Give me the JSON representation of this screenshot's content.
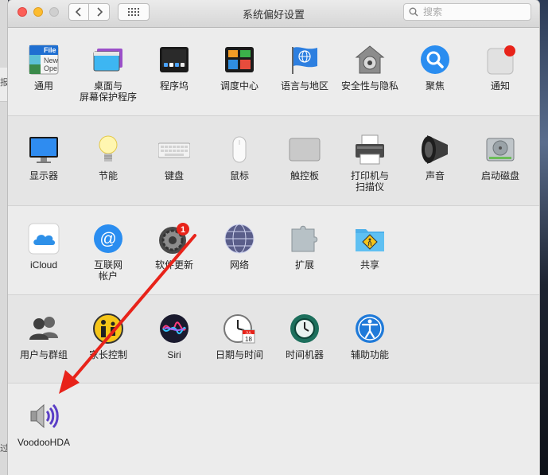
{
  "window": {
    "title": "系统偏好设置",
    "search_placeholder": "搜索"
  },
  "sections": [
    {
      "panes": [
        {
          "label": "通用",
          "icon": "general-file-icon",
          "icon_text": [
            "File",
            "New",
            "Ope"
          ]
        },
        {
          "label": "桌面与\n屏幕保护程序",
          "icon": "desktop-screensaver-icon"
        },
        {
          "label": "程序坞",
          "icon": "dock-icon"
        },
        {
          "label": "调度中心",
          "icon": "mission-control-icon"
        },
        {
          "label": "语言与地区",
          "icon": "language-region-flag-icon"
        },
        {
          "label": "安全性与隐私",
          "icon": "security-house-icon"
        },
        {
          "label": "聚焦",
          "icon": "spotlight-icon"
        },
        {
          "label": "通知",
          "icon": "notifications-icon"
        }
      ]
    },
    {
      "panes": [
        {
          "label": "显示器",
          "icon": "display-icon"
        },
        {
          "label": "节能",
          "icon": "energy-saver-bulb-icon"
        },
        {
          "label": "键盘",
          "icon": "keyboard-icon"
        },
        {
          "label": "鼠标",
          "icon": "mouse-icon"
        },
        {
          "label": "触控板",
          "icon": "trackpad-icon"
        },
        {
          "label": "打印机与\n扫描仪",
          "icon": "printer-icon"
        },
        {
          "label": "声音",
          "icon": "speaker-icon"
        },
        {
          "label": "启动磁盘",
          "icon": "startup-disk-icon"
        }
      ]
    },
    {
      "panes": [
        {
          "label": "iCloud",
          "icon": "icloud-icon"
        },
        {
          "label": "互联网\n帐户",
          "icon": "internet-accounts-icon"
        },
        {
          "label": "软件更新",
          "icon": "software-update-gear-icon",
          "badge": "1"
        },
        {
          "label": "网络",
          "icon": "network-globe-icon"
        },
        {
          "label": "扩展",
          "icon": "extensions-puzzle-icon"
        },
        {
          "label": "共享",
          "icon": "sharing-folder-icon"
        }
      ]
    },
    {
      "panes": [
        {
          "label": "用户与群组",
          "icon": "users-groups-icon"
        },
        {
          "label": "家长控制",
          "icon": "parental-controls-icon"
        },
        {
          "label": "Siri",
          "icon": "siri-icon"
        },
        {
          "label": "日期与时间",
          "icon": "date-time-clock-icon",
          "calendar_month": "JUL",
          "calendar_day": "18"
        },
        {
          "label": "时间机器",
          "icon": "time-machine-icon"
        },
        {
          "label": "辅助功能",
          "icon": "accessibility-icon"
        }
      ]
    },
    {
      "panes": [
        {
          "label": "VoodooHDA",
          "icon": "voodoohda-speaker-icon"
        }
      ]
    }
  ],
  "colors": {
    "annotation_arrow": "#e8231a",
    "badge": "#e8231a"
  },
  "background_left_chars": [
    "报",
    "过"
  ]
}
